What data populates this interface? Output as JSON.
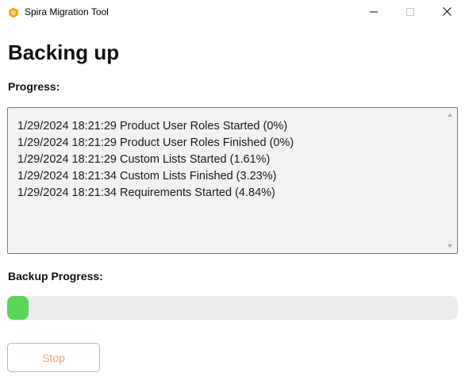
{
  "window": {
    "title": "Spira Migration Tool",
    "icon": "spira-hexagon-icon",
    "controls": [
      "minimize-icon",
      "maximize-icon",
      "close-icon"
    ]
  },
  "page": {
    "heading": "Backing up"
  },
  "progress_log": {
    "label": "Progress:",
    "lines": [
      "1/29/2024 18:21:29 Product User Roles Started (0%)",
      "1/29/2024 18:21:29 Product User Roles Finished (0%)",
      "1/29/2024 18:21:29 Custom Lists Started (1.61%)",
      "1/29/2024 18:21:34 Custom Lists Finished (3.23%)",
      "1/29/2024 18:21:34 Requirements Started (4.84%)"
    ]
  },
  "backup_progress": {
    "label": "Backup Progress:",
    "percent": 4.84,
    "fill_color": "#5bd55b"
  },
  "actions": {
    "stop_label": "Stop",
    "stop_color": "#e8a77a"
  }
}
